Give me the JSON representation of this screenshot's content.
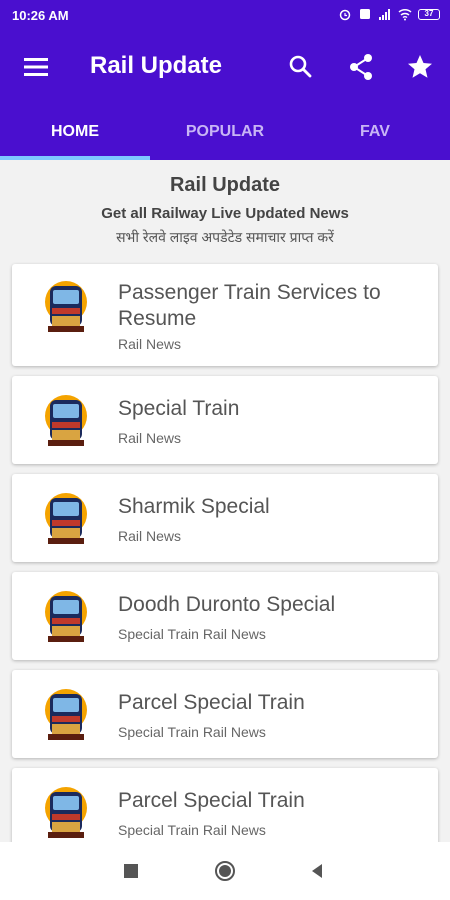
{
  "status_bar": {
    "time": "10:26 AM",
    "battery": "37"
  },
  "app_bar": {
    "title": "Rail Update"
  },
  "tabs": [
    {
      "label": "HOME",
      "active": true
    },
    {
      "label": "POPULAR",
      "active": false
    },
    {
      "label": "FAV",
      "active": false
    }
  ],
  "header": {
    "title": "Rail Update",
    "subtitle": "Get all Railway Live Updated News",
    "subtitle_hindi": "सभी रेलवे लाइव अपडेटेड समाचार प्राप्त करें"
  },
  "news": [
    {
      "title": "Passenger Train Services to Resume",
      "category": "Rail News"
    },
    {
      "title": "Special Train",
      "category": "Rail News"
    },
    {
      "title": "Sharmik Special",
      "category": "Rail News"
    },
    {
      "title": "Doodh Duronto Special",
      "category": "Special Train Rail News"
    },
    {
      "title": "Parcel Special Train",
      "category": "Special Train Rail News"
    },
    {
      "title": "Parcel Special Train",
      "category": "Special Train Rail News"
    }
  ],
  "icons": {
    "menu": "menu-icon",
    "search": "search-icon",
    "share": "share-icon",
    "star": "star-icon",
    "thumb": "train-icon",
    "nav_recent": "square-icon",
    "nav_home": "circle-icon",
    "nav_back": "triangle-icon"
  },
  "colors": {
    "primary": "#4a0fcf",
    "tab_indicator": "#7ec8ff",
    "inactive_tab": "#c8b5f5"
  }
}
